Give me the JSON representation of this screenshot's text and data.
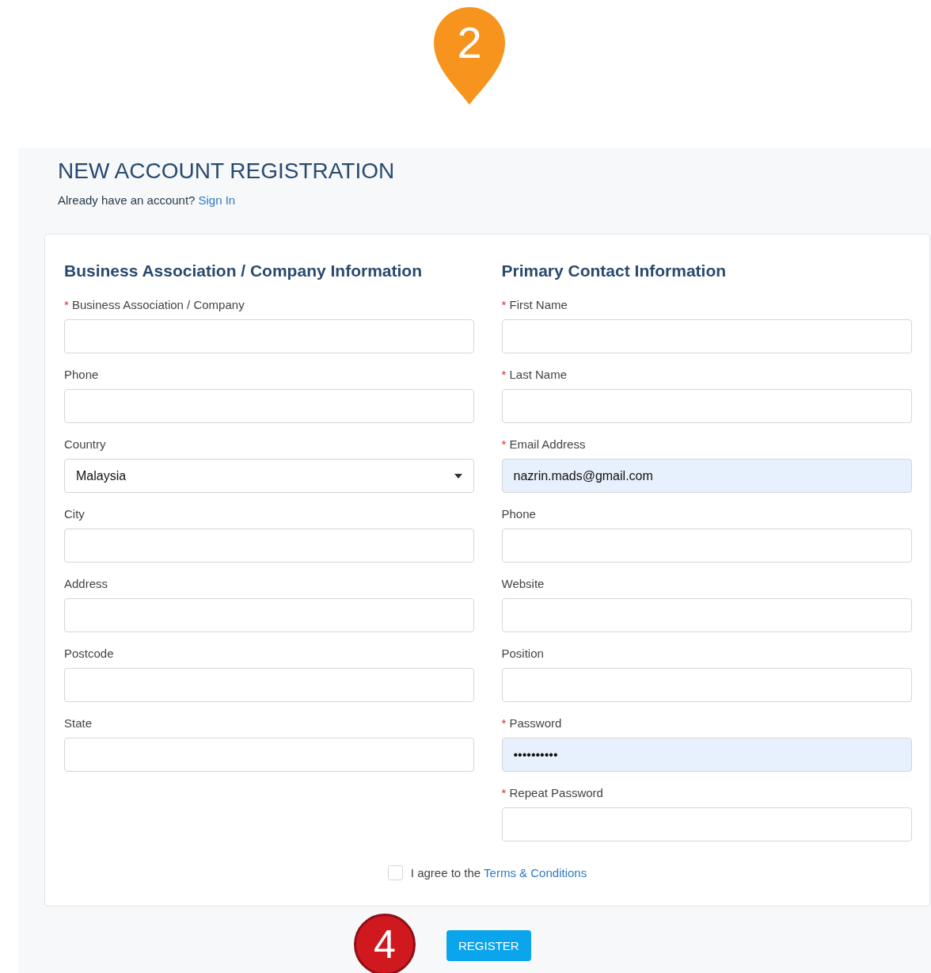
{
  "step_markers": [
    {
      "kind": "pin",
      "label": "2",
      "color": "#f7941d"
    },
    {
      "kind": "circle",
      "label": "4",
      "color": "#d0181f"
    }
  ],
  "page": {
    "title": "NEW ACCOUNT REGISTRATION",
    "prompt": "Already have an account?",
    "link": "Sign In"
  },
  "sections": [
    {
      "title": "Business Association / Company Information",
      "fields": [
        {
          "label": "Business Association / Company",
          "required_mark": "*",
          "kind": "text"
        },
        {
          "label": "Phone",
          "kind": "text"
        },
        {
          "label": "Country",
          "kind": "select",
          "value": "Malaysia"
        },
        {
          "label": "City",
          "kind": "text"
        },
        {
          "label": "Address",
          "kind": "text"
        },
        {
          "label": "Postcode",
          "kind": "text"
        },
        {
          "label": "State",
          "kind": "text"
        }
      ]
    },
    {
      "title": "Primary Contact Information",
      "fields": [
        {
          "label": "First Name",
          "required_mark": "*",
          "kind": "text"
        },
        {
          "label": "Last Name",
          "required_mark": "*",
          "kind": "text"
        },
        {
          "label": "Email Address",
          "required_mark": "*",
          "kind": "text",
          "value": "nazrin.mads@gmail.com",
          "autofilled": true
        },
        {
          "label": "Phone",
          "kind": "text"
        },
        {
          "label": "Website",
          "kind": "text"
        },
        {
          "label": "Position",
          "kind": "text"
        },
        {
          "label": "Password",
          "required_mark": "*",
          "kind": "text",
          "value": "••••••••••",
          "autofilled": true
        },
        {
          "label": "Repeat Password",
          "required_mark": "*",
          "kind": "text"
        }
      ]
    }
  ],
  "terms": {
    "checked": false,
    "text": "I agree to the",
    "link": "Terms & Conditions"
  },
  "register_button": "REGISTER"
}
